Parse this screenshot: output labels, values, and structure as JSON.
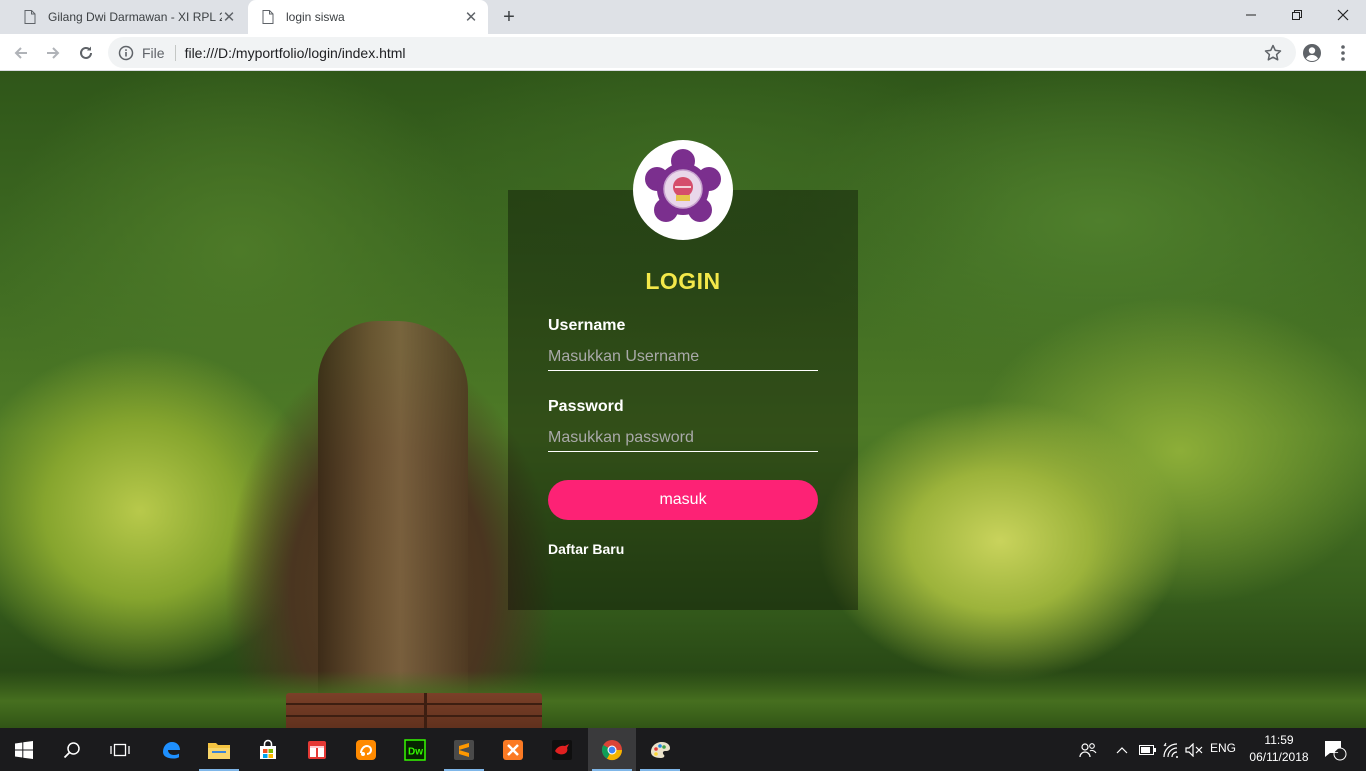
{
  "browser": {
    "tabs": [
      {
        "title": "Gilang Dwi Darmawan - XI RPL 2",
        "active": false
      },
      {
        "title": "login siswa",
        "active": true
      }
    ],
    "new_tab_glyph": "+",
    "window_controls": {
      "minimize": "minimize-icon",
      "restore": "restore-icon",
      "close": "close-icon"
    },
    "omnibox": {
      "security_label": "File",
      "url": "file:///D:/myportfolio/login/index.html"
    }
  },
  "login": {
    "title": "LOGIN",
    "username_label": "Username",
    "username_placeholder": "Masukkan Username",
    "password_label": "Password",
    "password_placeholder": "Masukkan password",
    "submit_label": "masuk",
    "register_link": "Daftar Baru"
  },
  "taskbar": {
    "apps": [
      {
        "name": "edge-icon",
        "running": false
      },
      {
        "name": "file-explorer-icon",
        "running": true
      },
      {
        "name": "store-icon",
        "running": false
      },
      {
        "name": "gift-icon",
        "running": false
      },
      {
        "name": "uc-browser-icon",
        "running": false
      },
      {
        "name": "dreamweaver-icon",
        "running": false
      },
      {
        "name": "sublime-text-icon",
        "running": true
      },
      {
        "name": "xampp-icon",
        "running": false
      },
      {
        "name": "game-icon",
        "running": false
      },
      {
        "name": "chrome-icon",
        "running": true
      },
      {
        "name": "paint-icon",
        "running": true
      }
    ],
    "language": "ENG",
    "time": "11:59",
    "date": "06/11/2018",
    "notification_count": "2"
  },
  "colors": {
    "accent_button": "#fd2275",
    "title_yellow": "#f3e84a",
    "taskbar_bg": "#1b1b1d"
  }
}
